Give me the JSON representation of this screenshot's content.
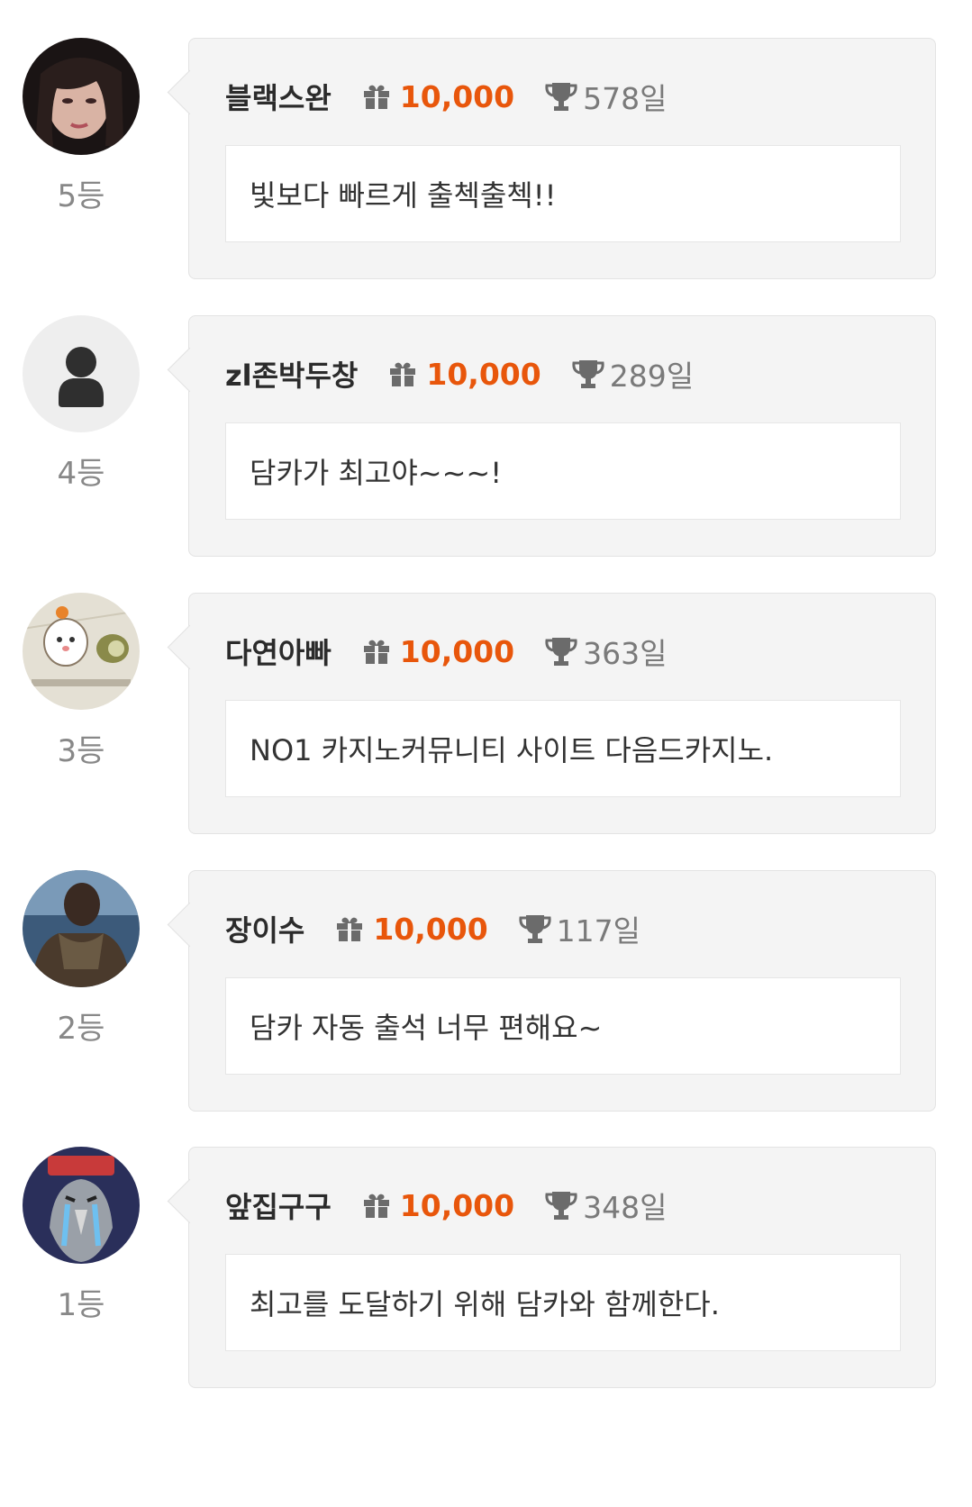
{
  "entries": [
    {
      "rank": "5등",
      "nickname": "블랙스완",
      "points": "10,000",
      "days": "578일",
      "message": "빛보다 빠르게 출첵출첵!!",
      "avatar": "photo-woman-icon"
    },
    {
      "rank": "4등",
      "nickname": "zl존박두창",
      "points": "10,000",
      "days": "289일",
      "message": "담카가 최고야~~~!",
      "avatar": "default-user-icon"
    },
    {
      "rank": "3등",
      "nickname": "다연아빠",
      "points": "10,000",
      "days": "363일",
      "message": "NO1 카지노커뮤니티 사이트 다음드카지노.",
      "avatar": "hamster-cartoon-icon"
    },
    {
      "rank": "2등",
      "nickname": "장이수",
      "points": "10,000",
      "days": "117일",
      "message": "담카 자동 출석 너무 편해요~",
      "avatar": "photo-man-icon"
    },
    {
      "rank": "1등",
      "nickname": "앞집구구",
      "points": "10,000",
      "days": "348일",
      "message": "최고를 도달하기 위해 담카와 함께한다.",
      "avatar": "crying-cartoon-icon"
    }
  ],
  "colors": {
    "points": "#e8560b",
    "card_bg": "#f4f4f4",
    "rank_text": "#888888"
  }
}
